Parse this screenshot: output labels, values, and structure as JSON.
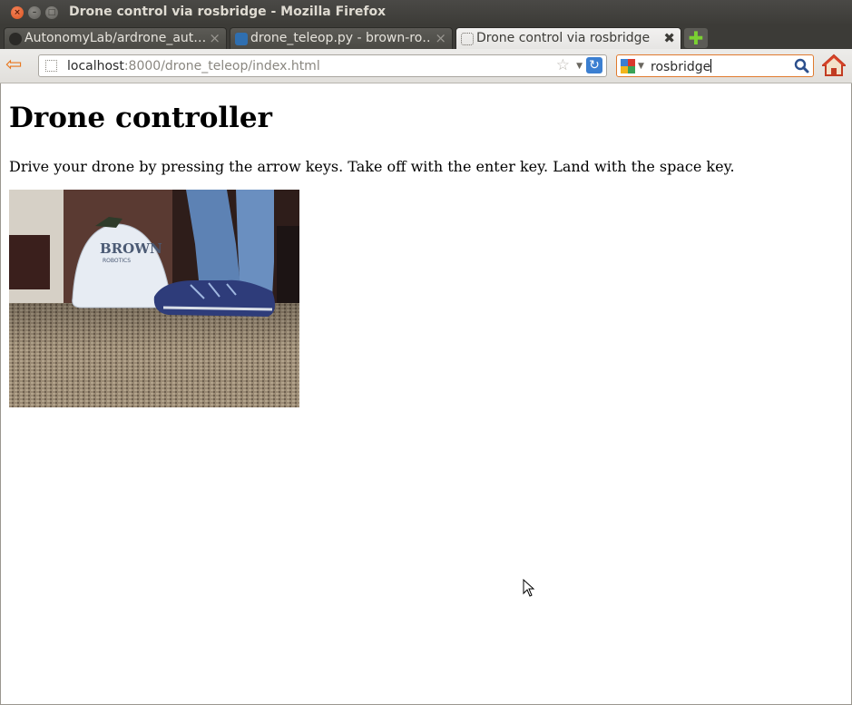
{
  "window": {
    "title": "Drone control via rosbridge - Mozilla Firefox",
    "close_glyph": "×",
    "min_glyph": "–",
    "max_glyph": "□"
  },
  "tabs": [
    {
      "label": "AutonomyLab/ardrone_aut…",
      "close_glyph": "×"
    },
    {
      "label": "drone_teleop.py - brown-ro…",
      "close_glyph": "×"
    },
    {
      "label": "Drone control via rosbridge",
      "close_glyph": "✖"
    }
  ],
  "new_tab_glyph": "✚",
  "navbar": {
    "url_host": "localhost",
    "url_path": ":8000/drone_teleop/index.html",
    "search_query": "rosbridge",
    "star_glyph": "☆",
    "reload_glyph": "↻",
    "dropdown_glyph": "▼",
    "back_glyph": "⇦"
  },
  "page": {
    "heading": "Drone controller",
    "instructions": "Drive your drone by pressing the arrow keys. Take off with the enter key. Land with the space key.",
    "camera_logo_line1": "BROWN",
    "camera_logo_line2": "ROBOTICS"
  },
  "colors": {
    "accent_orange": "#e8761d",
    "titlebar": "#3c3b37",
    "reload_blue": "#3b7fd1"
  },
  "icons": {
    "back": "back-arrow-icon",
    "reload": "reload-icon",
    "bookmark": "star-icon",
    "search": "magnifier-icon",
    "home": "home-icon",
    "new_tab": "plus-icon"
  }
}
